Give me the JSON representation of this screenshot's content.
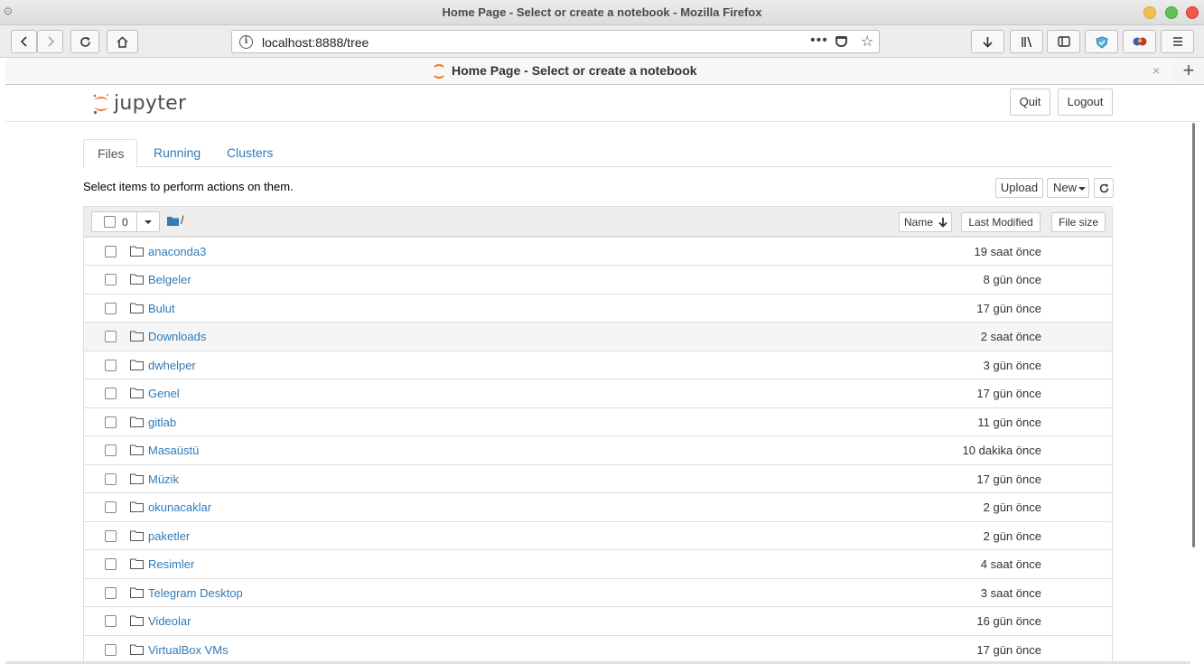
{
  "window": {
    "title": "Home Page - Select or create a notebook - Mozilla Firefox"
  },
  "browser": {
    "url": "localhost:8888/tree",
    "tab_title": "Home Page - Select or create a notebook",
    "page_actions_glyph": "•••",
    "bookmark_glyph": "☆",
    "new_tab_glyph": "+",
    "tab_close_glyph": "×",
    "info_glyph": "i"
  },
  "jupyter": {
    "logo_text": "jupyter",
    "quit_label": "Quit",
    "logout_label": "Logout",
    "tabs": [
      {
        "label": "Files",
        "active": true
      },
      {
        "label": "Running",
        "active": false
      },
      {
        "label": "Clusters",
        "active": false
      }
    ],
    "hint": "Select items to perform actions on them.",
    "upload_label": "Upload",
    "new_label": "New",
    "selected_count": "0",
    "breadcrumb": "/",
    "columns": {
      "name": "Name",
      "last_modified": "Last Modified",
      "file_size": "File size"
    },
    "items": [
      {
        "name": "anaconda3",
        "modified": "19 saat önce"
      },
      {
        "name": "Belgeler",
        "modified": "8 gün önce"
      },
      {
        "name": "Bulut",
        "modified": "17 gün önce"
      },
      {
        "name": "Downloads",
        "modified": "2 saat önce"
      },
      {
        "name": "dwhelper",
        "modified": "3 gün önce"
      },
      {
        "name": "Genel",
        "modified": "17 gün önce"
      },
      {
        "name": "gitlab",
        "modified": "11 gün önce"
      },
      {
        "name": "Masaüstü",
        "modified": "10 dakika önce"
      },
      {
        "name": "Müzik",
        "modified": "17 gün önce"
      },
      {
        "name": "okunacaklar",
        "modified": "2 gün önce"
      },
      {
        "name": "paketler",
        "modified": "2 gün önce"
      },
      {
        "name": "Resimler",
        "modified": "4 saat önce"
      },
      {
        "name": "Telegram Desktop",
        "modified": "3 saat önce"
      },
      {
        "name": "Videolar",
        "modified": "16 gün önce"
      },
      {
        "name": "VirtualBox VMs",
        "modified": "17 gün önce"
      }
    ]
  },
  "colors": {
    "link": "#337ab7",
    "jupyter_orange": "#f37726"
  }
}
